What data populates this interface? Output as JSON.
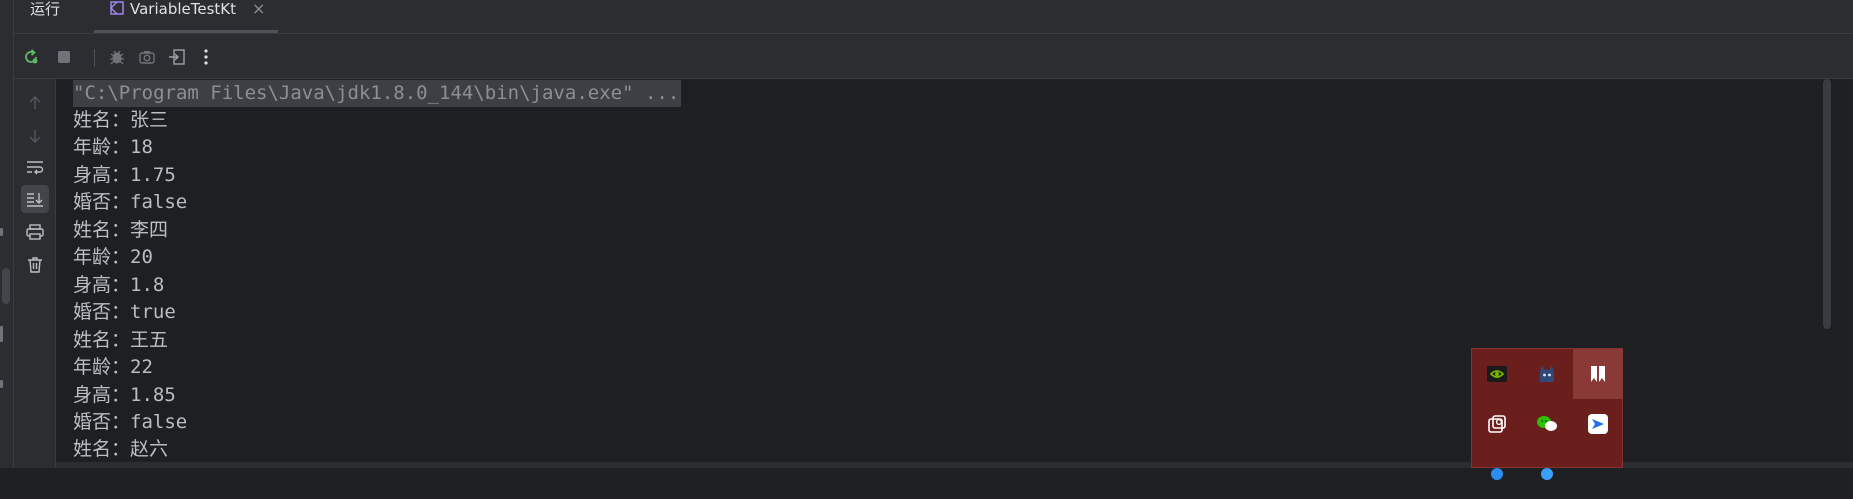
{
  "tabbar": {
    "run_label": "运行",
    "tab_label": "VariableTestKt",
    "close_glyph": "×"
  },
  "toolbar": {
    "icons": [
      "rerun-icon",
      "stop-icon",
      "debug-icon",
      "screenshot-icon",
      "exit-icon",
      "more-icon"
    ]
  },
  "sidebar": {
    "icons": [
      "arrow-up-icon",
      "arrow-down-icon",
      "soft-wrap-icon",
      "scroll-to-end-icon",
      "print-icon",
      "trash-icon"
    ]
  },
  "console": {
    "command": "\"C:\\Program Files\\Java\\jdk1.8.0_144\\bin\\java.exe\" ...",
    "lines": [
      "姓名：张三",
      "年龄：18",
      "身高：1.75",
      "婚否：false",
      "姓名：李四",
      "年龄：20",
      "身高：1.8",
      "婚否：true",
      "姓名：王五",
      "年龄：22",
      "身高：1.85",
      "婚否：false",
      "姓名：赵六"
    ]
  },
  "tray": {
    "icons": [
      "nvidia-icon",
      "cat-app-icon",
      "bookmark-app-icon",
      "screen-capture-icon",
      "wechat-icon",
      "feishu-icon",
      "blue-app-icon",
      "blue-app-icon-2"
    ]
  },
  "colors": {
    "background": "#1e1f22",
    "panel": "#2b2d30",
    "text": "#bcbec4",
    "tray_bg": "#6b1f1d",
    "accent_green": "#5fb865"
  }
}
